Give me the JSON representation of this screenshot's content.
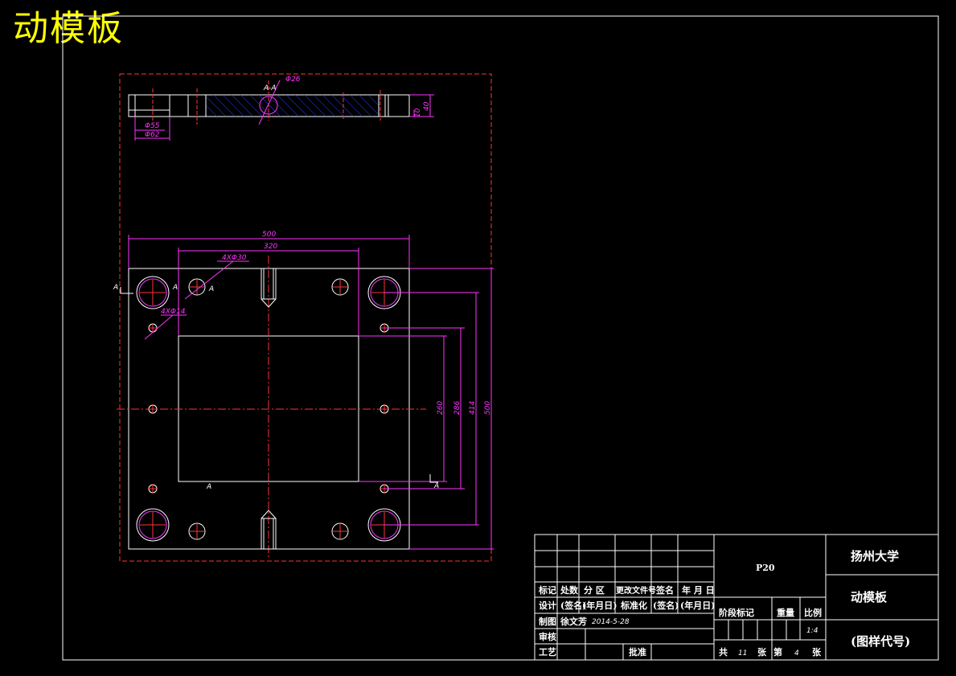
{
  "drawing_title": "动模板",
  "section_label": "A-A",
  "top_view": {
    "dim_phi26": "Φ26",
    "dim_phi55": "Φ55",
    "dim_phi62": "Φ62",
    "dim_40": "40",
    "dim_10": "10"
  },
  "plan_view": {
    "dim_500_w": "500",
    "dim_320": "320",
    "dim_4x30": "4XΦ30",
    "dim_4x14": "4XΦ14",
    "dim_260": "260",
    "dim_286": "286",
    "dim_414": "414",
    "dim_500_h": "500",
    "marker_a": "A",
    "marker_a_bottom": "A"
  },
  "title_block": {
    "header": [
      "标记",
      "处数",
      "分  区",
      "更改文件号",
      "签名",
      "年 月 日"
    ],
    "row_design": [
      "设计",
      "(签名)",
      "(年月日)",
      "标准化",
      "(签名)",
      "(年月日)"
    ],
    "row_draw": [
      "制图",
      "徐文芳",
      "2014-5-28"
    ],
    "row_check": "审核",
    "row_process": "工艺",
    "approve": "批准",
    "material": "P20",
    "stage_mark": "阶段标记",
    "weight": "重量",
    "scale": "比例",
    "scale_value": "1:4",
    "sheet_total_label": "共",
    "sheet_total": "11",
    "sheet_unit": "张",
    "sheet_no_label": "第",
    "sheet_no": "4",
    "sheet_no_unit": "张",
    "school": "扬州大学",
    "part_name": "动模板",
    "drawing_no": "(图样代号)"
  }
}
